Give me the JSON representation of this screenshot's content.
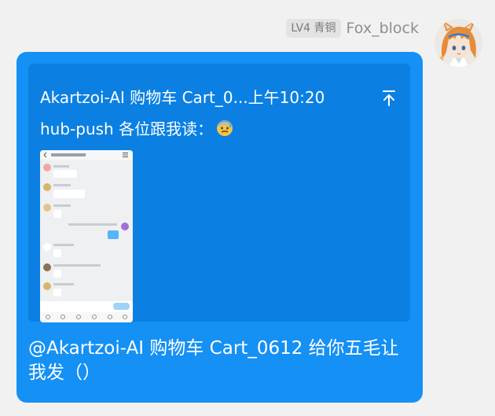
{
  "sender": {
    "level_badge": "LV4 青铜",
    "nickname": "Fox_block",
    "avatar_icon": "anime-fox-avatar"
  },
  "message": {
    "quote": {
      "title": "Akartzoi-AI 购物车 Cart_0...上午10:20",
      "text": "hub-push 各位跟我读：",
      "emoji_icon": "anxious-sweat-emoji",
      "pin_icon": "scroll-to-top-icon",
      "thumbnail_icon": "chat-screenshot-thumbnail"
    },
    "text": "@Akartzoi-AI 购物车 Cart_0612 给你五毛让我发（）"
  },
  "colors": {
    "bubble": "#1590f4",
    "quote_card": "#0b80e2",
    "background": "#f1f1f1"
  }
}
